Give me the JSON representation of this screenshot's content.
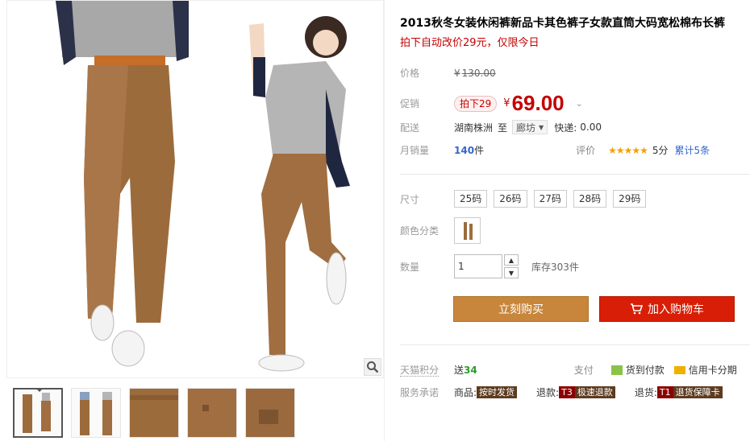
{
  "product": {
    "title": "2013秋冬女装休闲裤新品卡其色裤子女款直筒大码宽松棉布长裤",
    "subtitle": "拍下自动改价29元，仅限今日"
  },
  "price": {
    "label": "价格",
    "currency": "¥",
    "original": "130.00"
  },
  "promo": {
    "label": "促销",
    "tag": "拍下29",
    "currency": "¥",
    "price": "69.00"
  },
  "shipping": {
    "label": "配送",
    "origin": "湖南株洲",
    "to_label": "至",
    "destination": "廊坊",
    "express_label": "快递:",
    "express_fee": "0.00"
  },
  "sales": {
    "label": "月销量",
    "count": "140",
    "unit": "件",
    "rating_label": "评价",
    "stars": "★★★★★",
    "score": "5分",
    "reviews": "累计5条"
  },
  "size": {
    "label": "尺寸",
    "options": [
      "25码",
      "26码",
      "27码",
      "28码",
      "29码"
    ]
  },
  "color": {
    "label": "颜色分类"
  },
  "quantity": {
    "label": "数量",
    "value": "1",
    "stock": "库存303件"
  },
  "actions": {
    "buy_now": "立刻购买",
    "add_cart": "加入购物车"
  },
  "points": {
    "label": "天猫积分",
    "send": "送",
    "value": "34",
    "pay_label": "支付",
    "cod": "货到付款",
    "credit": "信用卡分期"
  },
  "service": {
    "label": "服务承诺",
    "goods_label": "商品:",
    "goods_tag": "按时发货",
    "refund_label": "退款:",
    "refund_code": "T3",
    "refund_tag": "极速退款",
    "return_label": "退货:",
    "return_code": "T1",
    "return_tag": "退货保障卡"
  },
  "colors": {
    "accent_red": "#c40000",
    "buy_orange": "#c8863c",
    "cart_red": "#d81e06",
    "pants_khaki": "#9c6b3c"
  }
}
